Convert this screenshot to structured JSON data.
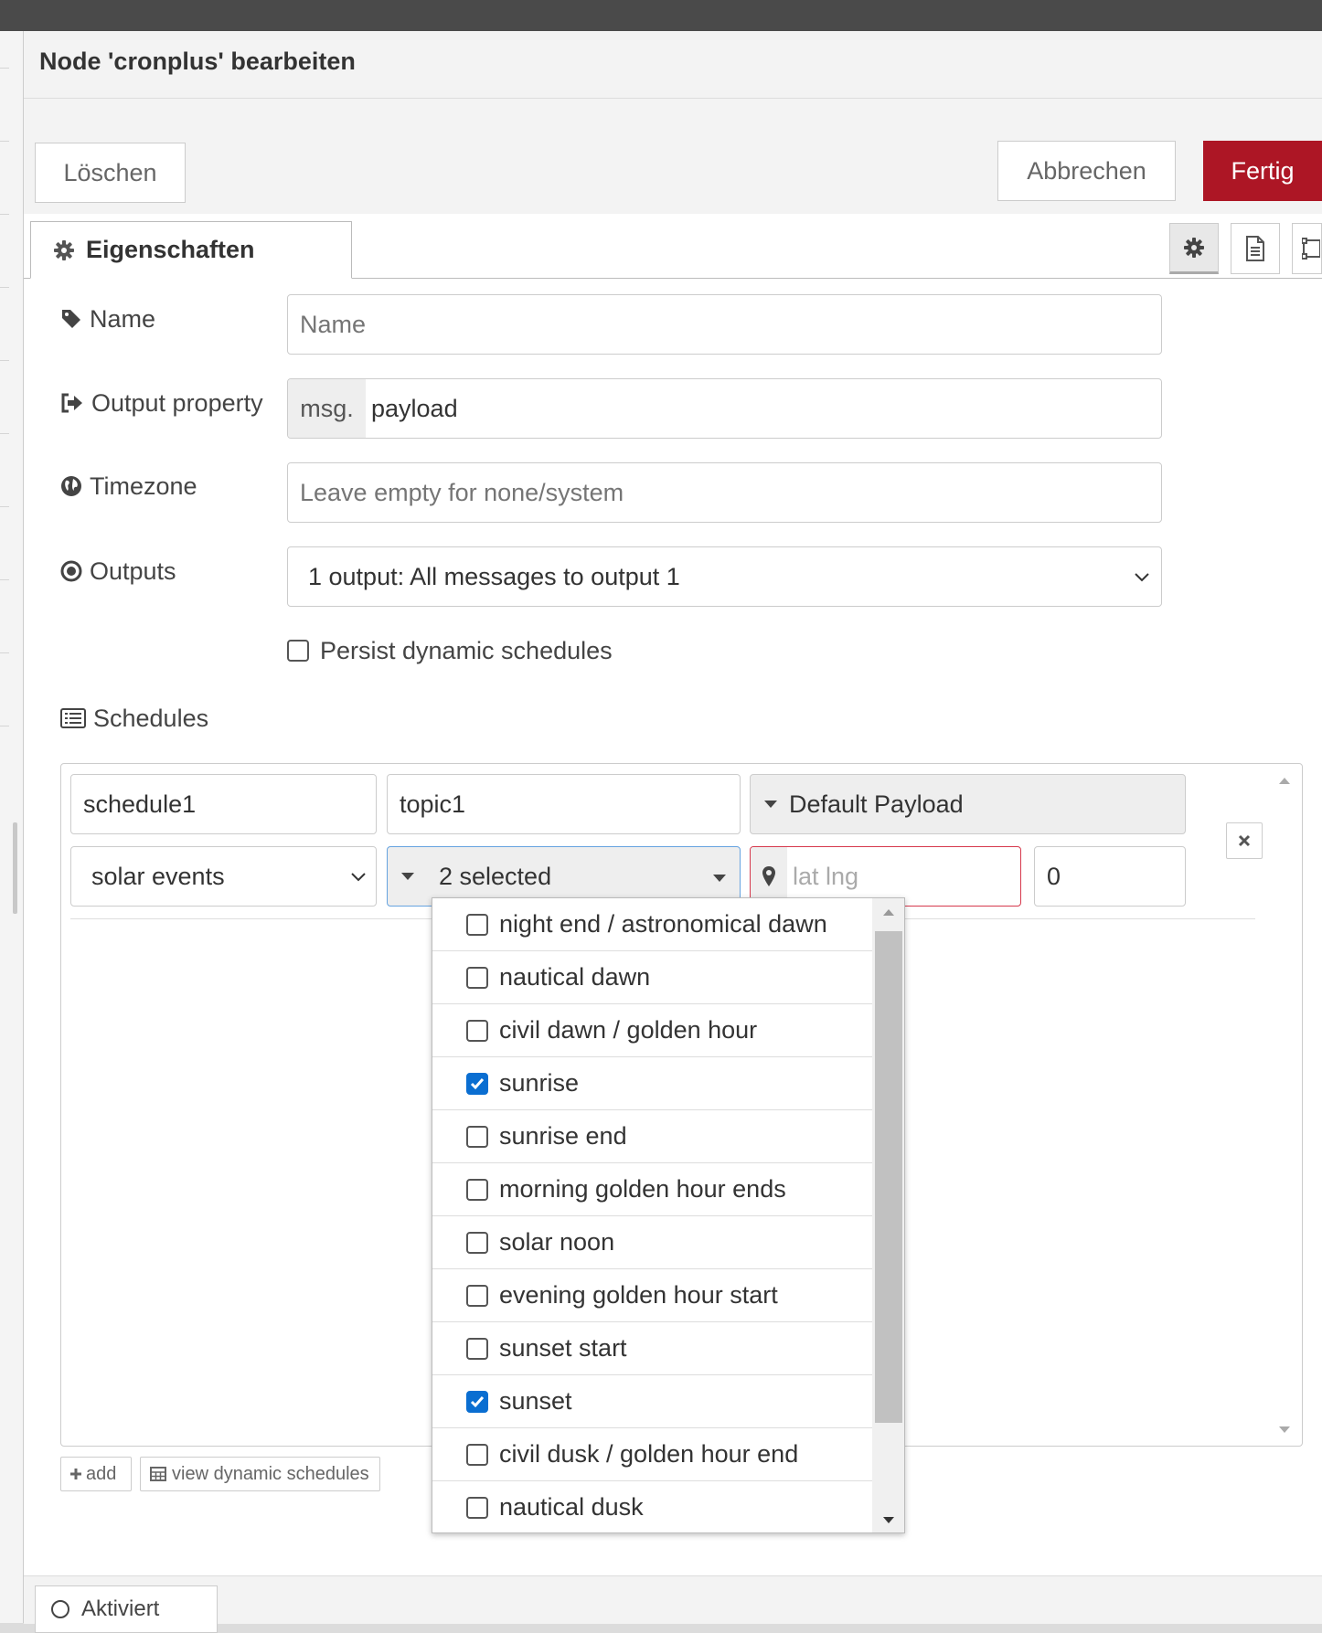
{
  "dialog": {
    "title": "Node 'cronplus' bearbeiten",
    "delete_label": "Löschen",
    "cancel_label": "Abbrechen",
    "done_label": "Fertig",
    "done_color": "#ad1625"
  },
  "tabs": {
    "properties_label": "Eigenschaften",
    "icons": [
      "gear-icon",
      "document-icon",
      "frame-icon"
    ]
  },
  "form": {
    "name_label": "Name",
    "name_placeholder": "Name",
    "output_label": "Output property",
    "output_prefix": "msg.",
    "output_value": "payload",
    "timezone_label": "Timezone",
    "timezone_placeholder": "Leave empty for none/system",
    "outputs_label": "Outputs",
    "outputs_value": "1 output: All messages to output 1",
    "persist_label": "Persist dynamic schedules",
    "persist_checked": false,
    "schedules_label": "Schedules"
  },
  "schedule": {
    "name": "schedule1",
    "topic": "topic1",
    "payload_type": "Default Payload",
    "event_type": "solar events",
    "selection": "2 selected",
    "location_placeholder": "lat lng",
    "offset": "0"
  },
  "buttons": {
    "add_label": "add",
    "view_label": "view dynamic schedules"
  },
  "solar_options": [
    {
      "label": "night end / astronomical dawn",
      "checked": false
    },
    {
      "label": "nautical dawn",
      "checked": false
    },
    {
      "label": "civil dawn / golden hour",
      "checked": false
    },
    {
      "label": "sunrise",
      "checked": true
    },
    {
      "label": "sunrise end",
      "checked": false
    },
    {
      "label": "morning golden hour ends",
      "checked": false
    },
    {
      "label": "solar noon",
      "checked": false
    },
    {
      "label": "evening golden hour start",
      "checked": false
    },
    {
      "label": "sunset start",
      "checked": false
    },
    {
      "label": "sunset",
      "checked": true
    },
    {
      "label": "civil dusk / golden hour end",
      "checked": false
    },
    {
      "label": "nautical dusk",
      "checked": false
    }
  ],
  "footer": {
    "enabled_label": "Aktiviert"
  },
  "colors": {
    "accent": "#0a6ed1",
    "primary": "#ad1625",
    "error_border": "#d6394d"
  }
}
